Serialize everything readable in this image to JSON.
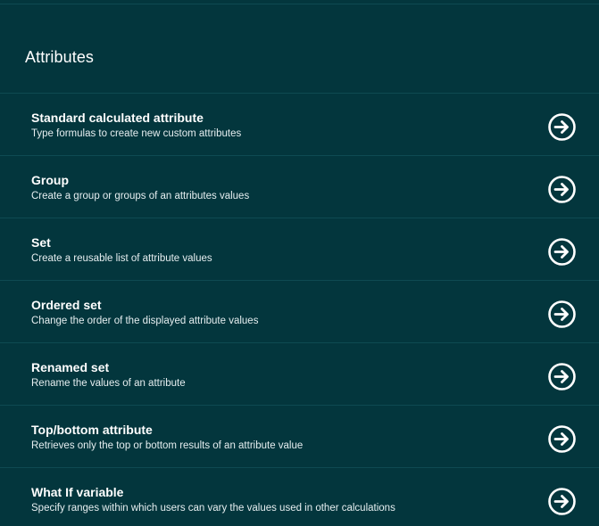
{
  "section": {
    "title": "Attributes"
  },
  "colors": {
    "background": "#03363d",
    "divider": "#0e4a52",
    "text": "#ffffff"
  },
  "items": [
    {
      "title": "Standard calculated attribute",
      "description": "Type formulas to create new custom attributes",
      "icon": "arrow-right-circle-icon"
    },
    {
      "title": "Group",
      "description": "Create a group or groups of an attributes values",
      "icon": "arrow-right-circle-icon"
    },
    {
      "title": "Set",
      "description": "Create a reusable list of attribute values",
      "icon": "arrow-right-circle-icon"
    },
    {
      "title": "Ordered set",
      "description": "Change the order of the displayed attribute values",
      "icon": "arrow-right-circle-icon"
    },
    {
      "title": "Renamed set",
      "description": "Rename the values of an attribute",
      "icon": "arrow-right-circle-icon"
    },
    {
      "title": "Top/bottom attribute",
      "description": "Retrieves only the top or bottom results of an attribute value",
      "icon": "arrow-right-circle-icon"
    },
    {
      "title": "What If variable",
      "description": "Specify ranges within which users can vary the values used in other calculations",
      "icon": "arrow-right-circle-icon"
    }
  ]
}
